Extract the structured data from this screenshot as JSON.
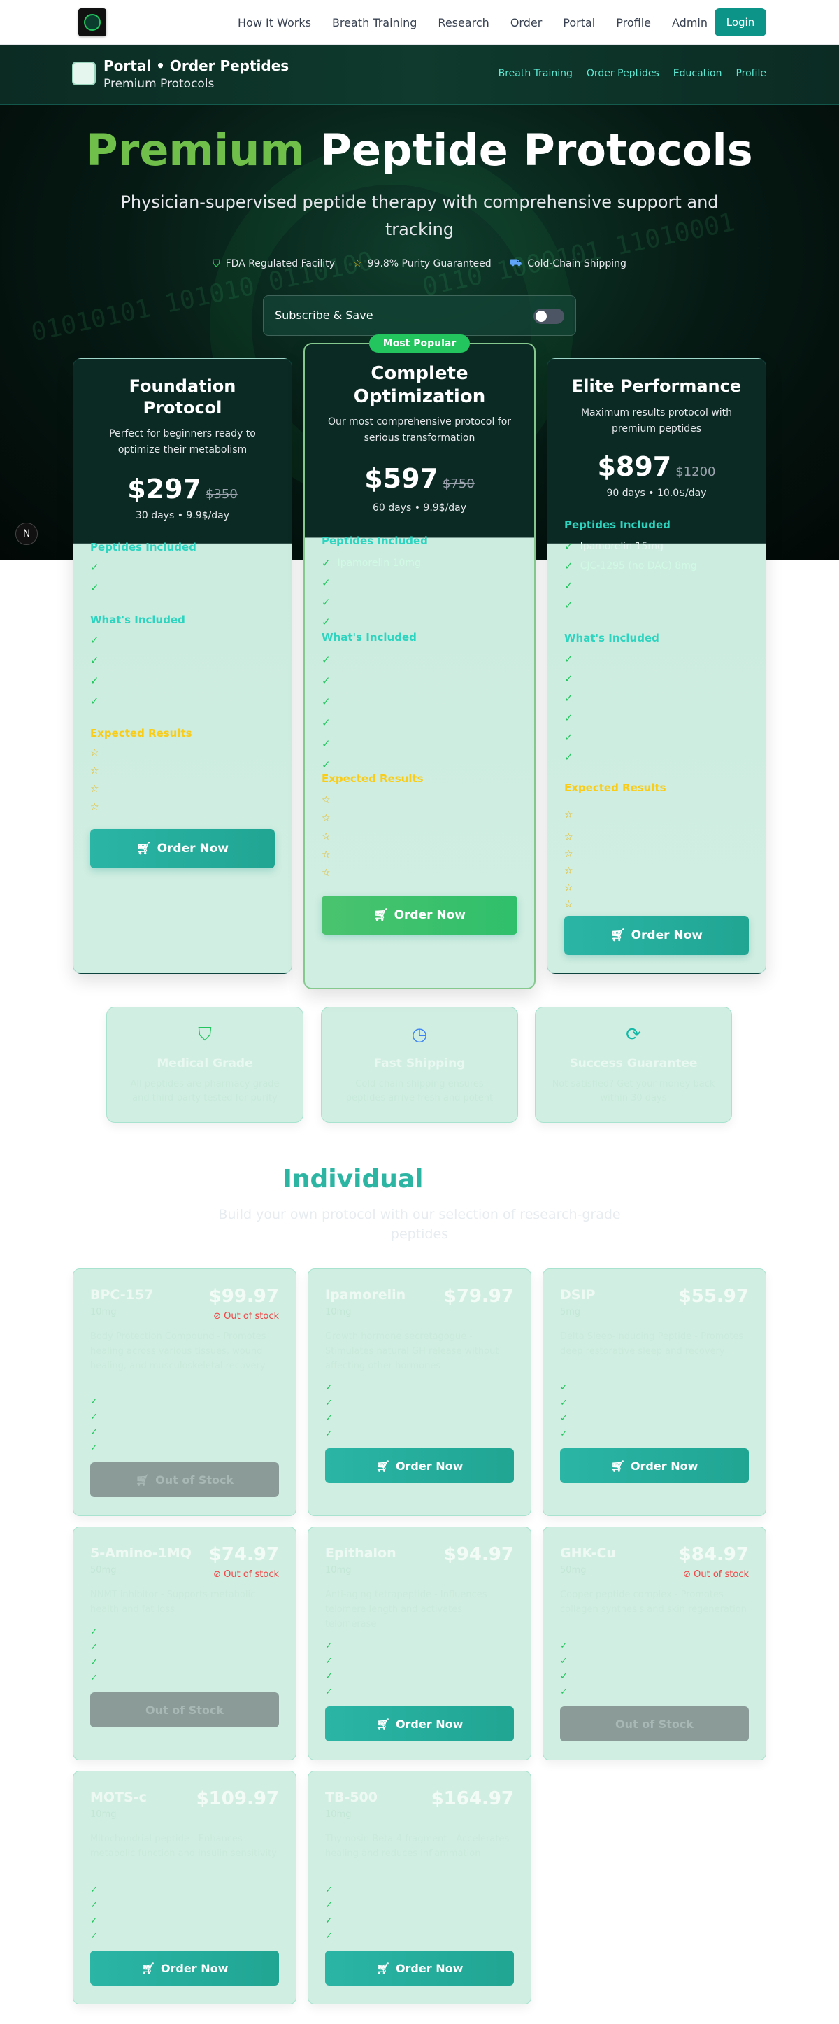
{
  "nav": {
    "links": [
      "How It Works",
      "Breath Training",
      "Research",
      "Order",
      "Portal",
      "Profile",
      "Admin"
    ],
    "login": "Login"
  },
  "subbar": {
    "title": "Portal • Order Peptides",
    "subtitle": "Premium Protocols",
    "links": [
      "Breath Training",
      "Order Peptides",
      "Education",
      "Profile"
    ]
  },
  "hero": {
    "title_green": "Premium",
    "title_white": "Peptide Protocols",
    "subtitle": "Physician-supervised peptide therapy with comprehensive support and tracking",
    "badges": [
      "FDA Regulated Facility",
      "99.8% Purity Guaranteed",
      "Cold-Chain Shipping"
    ],
    "subscribe": "Subscribe & Save"
  },
  "popular": "Most Popular",
  "sections": {
    "peptides": "Peptides Included",
    "included": "What's Included",
    "results": "Expected Results"
  },
  "plans": [
    {
      "title": "Foundation Protocol",
      "desc": "Perfect for beginners ready to optimize their metabolism",
      "price": "$297",
      "old": "$350",
      "duration": "30 days • 9.9$/day",
      "peptides": [
        "",
        "",
        ""
      ],
      "included": [
        "",
        "",
        "",
        ""
      ],
      "results": [
        "",
        "",
        "",
        ""
      ],
      "button": "Order Now"
    },
    {
      "title": "Complete Optimization",
      "desc": "Our most comprehensive protocol for serious transformation",
      "price": "$597",
      "old": "$750",
      "duration": "60 days • 9.9$/day",
      "peptides": [
        "Ipamorelin 10mg",
        "",
        "",
        ""
      ],
      "included": [
        "",
        "",
        "",
        "",
        "",
        ""
      ],
      "results": [
        "",
        "",
        "",
        "",
        ""
      ],
      "button": "Order Now"
    },
    {
      "title": "Elite Performance",
      "desc": "Maximum results protocol with premium peptides",
      "price": "$897",
      "old": "$1200",
      "duration": "90 days • 10.0$/day",
      "peptides": [
        "Ipamorelin 15mg",
        "CJC-1295 (no DAC) 8mg",
        "",
        ""
      ],
      "included": [
        "",
        "",
        "",
        "",
        "",
        ""
      ],
      "results": [
        "",
        "",
        "",
        "",
        "",
        ""
      ],
      "button": "Order Now"
    }
  ],
  "features": [
    {
      "title": "Medical Grade",
      "desc": "All peptides are pharmacy-grade and third-party tested for purity"
    },
    {
      "title": "Fast Shipping",
      "desc": "Cold-chain shipping ensures peptides arrive fresh and potent"
    },
    {
      "title": "Success Guarantee",
      "desc": "Not satisfied? Get your money back within 30 days"
    }
  ],
  "individual": {
    "title": "Individual",
    "subtitle": "Build your own protocol with our selection of research-grade peptides"
  },
  "products": [
    {
      "name": "BPC-157",
      "dose": "10mg",
      "price": "$99.97",
      "stock": "Out of stock",
      "desc": "Body Protection Compound - Promotes healing across various tissues, wound healing, and musculoskeletal recovery",
      "button": "Out of Stock"
    },
    {
      "name": "Ipamorelin",
      "dose": "10mg",
      "price": "$79.97",
      "stock": "",
      "desc": "Growth hormone secretagogue - Stimulates natural GH release without affecting other hormones",
      "button": "Order Now"
    },
    {
      "name": "DSIP",
      "dose": "5mg",
      "price": "$55.97",
      "stock": "",
      "desc": "Delta Sleep-Inducing Peptide - Promotes deep restorative sleep and recovery",
      "button": "Order Now"
    },
    {
      "name": "5-Amino-1MQ",
      "dose": "50mg",
      "price": "$74.97",
      "stock": "Out of stock",
      "desc": "NNMT inhibitor - Supports metabolic health and fat loss",
      "button": "Out of Stock"
    },
    {
      "name": "Epithalon",
      "dose": "10mg",
      "price": "$94.97",
      "stock": "",
      "desc": "Anti-aging tetrapeptide - Influences telomere length and activates telomerase",
      "button": "Order Now"
    },
    {
      "name": "GHK-Cu",
      "dose": "50mg",
      "price": "$84.97",
      "stock": "Out of stock",
      "desc": "Copper peptide complex - Promotes collagen synthesis and skin regeneration",
      "button": "Out of Stock"
    },
    {
      "name": "MOTS-c",
      "dose": "10mg",
      "price": "$109.97",
      "stock": "",
      "desc": "Mitochondrial peptide - Enhances metabolic function and insulin sensitivity",
      "button": "Order Now"
    },
    {
      "name": "TB-500",
      "dose": "10mg",
      "price": "$164.97",
      "stock": "",
      "desc": "Thymosin Beta-4 fragment - Accelerates healing and reduces inflammation",
      "button": "Order Now"
    }
  ]
}
